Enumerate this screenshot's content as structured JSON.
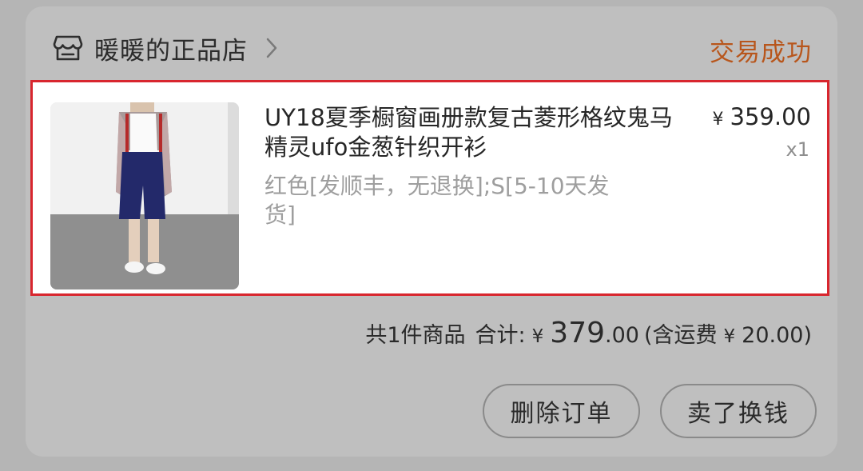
{
  "shop": {
    "icon": "store-icon",
    "name": "暖暖的正品店",
    "chevron_icon": "chevron-right-icon"
  },
  "order": {
    "status": "交易成功",
    "status_color": "#b8561c"
  },
  "item": {
    "title": "UY18夏季橱窗画册款复古菱形格纹鬼马精灵ufo金葱针织开衫",
    "sku": "红色[发顺丰，无退换];S[5-10天发货]",
    "price_currency": "¥",
    "price_value": "359.00",
    "quantity": "x1",
    "highlight_color": "#d8262e"
  },
  "summary": {
    "count_text": "共1件商品",
    "total_label": "合计:",
    "currency": "¥",
    "total_integer": "379",
    "total_decimal": ".00",
    "shipping_prefix": "(含运费",
    "shipping_currency": "¥",
    "shipping_value": "20.00)"
  },
  "actions": {
    "delete_label": "删除订单",
    "resell_label": "卖了换钱"
  }
}
